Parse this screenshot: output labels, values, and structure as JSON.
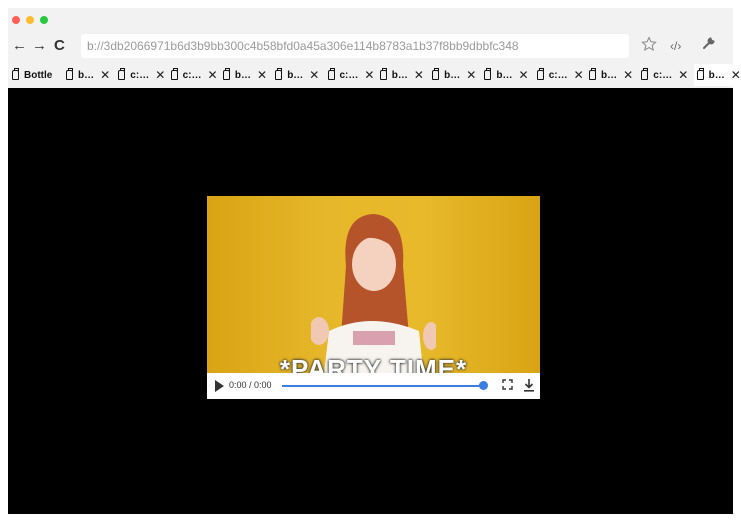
{
  "browser": {
    "url": "b://3db2066971b6d3b9bb300c4b58bfd0a45a306e114b8783a1b37f8bb9dbbfc348",
    "nav": {
      "back": "←",
      "forward": "→",
      "reload": "C"
    },
    "tools": {
      "bookmark": "star-icon",
      "devtools": "code-icon",
      "settings": "wrench-icon"
    }
  },
  "tabs": [
    {
      "label": "Bottle",
      "closable": false
    },
    {
      "label": "b…"
    },
    {
      "label": "c:…"
    },
    {
      "label": "c:…"
    },
    {
      "label": "b…"
    },
    {
      "label": "b…"
    },
    {
      "label": "c:…"
    },
    {
      "label": "b…"
    },
    {
      "label": "b…"
    },
    {
      "label": "b…"
    },
    {
      "label": "c:…"
    },
    {
      "label": "b…"
    },
    {
      "label": "c:…"
    },
    {
      "label": "b…",
      "active": true
    }
  ],
  "tab_close_glyph": "✕",
  "new_tab": "+",
  "video": {
    "caption": "*PARTY TIME*",
    "time": "0:00 / 0:00",
    "progress": 0.98,
    "accent": "#3c7de0",
    "background": "#e3b21f"
  },
  "page_bg": "#000000"
}
